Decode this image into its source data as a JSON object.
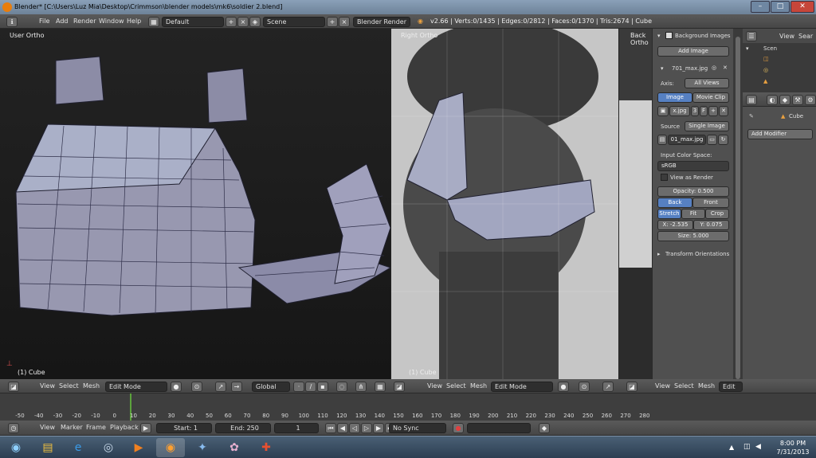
{
  "window": {
    "title": "Blender* [C:\\Users\\Luz Mia\\Desktop\\Crimmson\\blender models\\mk6\\soldier 2.blend]",
    "min": "–",
    "max": "□",
    "close": "✕"
  },
  "info_header": {
    "menus": [
      "File",
      "Add",
      "Render",
      "Window",
      "Help"
    ],
    "layout": "Default",
    "scene": "Scene",
    "engine": "Blender Render",
    "stats": "v2.66 | Verts:0/1435 | Edges:0/2812 | Faces:0/1370 | Tris:2674 | Cube"
  },
  "viewports": {
    "left": {
      "label": "User Ortho",
      "caption": "(1) Cube"
    },
    "middle": {
      "label": "Right Ortho",
      "caption": "(1) Cube"
    },
    "right": {
      "label": "Back Ortho"
    }
  },
  "props": {
    "section": "Background Images",
    "add_image": "Add Image",
    "image_name": "701_max.jpg",
    "axis_label": "Axis:",
    "axis_value": "All Views",
    "tab_image": "Image",
    "tab_movie": "Movie Clip",
    "img_file": "x.jpg",
    "img_users": "3",
    "img_f": "F",
    "source_label": "Source",
    "source_value": "Single Image",
    "file_path": "01_max.jpg",
    "color_space_label": "Input Color Space:",
    "color_space": "sRGB",
    "view_as_render": "View as Render",
    "opacity": "Opacity: 0.500",
    "back": "Back",
    "front": "Front",
    "stretch": "Stretch",
    "fit": "Fit",
    "crop": "Crop",
    "x": "X: -2.535",
    "y": "Y: 0.075",
    "size": "Size: 5.000",
    "transform": "Transform Orientations"
  },
  "outliner": {
    "view": "View",
    "search": "Sear",
    "scene": "Scen"
  },
  "modifier": {
    "object": "Cube",
    "add": "Add Modifier"
  },
  "viewport_header": {
    "view": "View",
    "select": "Select",
    "mesh": "Mesh",
    "mode": "Edit Mode",
    "orientation": "Global",
    "mode_short": "Edit"
  },
  "timeline": {
    "ticks": [
      "-50",
      "-40",
      "-30",
      "-20",
      "-10",
      "0",
      "10",
      "20",
      "30",
      "40",
      "50",
      "60",
      "70",
      "80",
      "90",
      "100",
      "110",
      "120",
      "130",
      "140",
      "150",
      "160",
      "170",
      "180",
      "190",
      "200",
      "210",
      "220",
      "230",
      "240",
      "250",
      "260",
      "270",
      "280"
    ],
    "view": "View",
    "marker": "Marker",
    "frame": "Frame",
    "playback": "Playback",
    "start": "Start: 1",
    "end": "End: 250",
    "current": "1",
    "sync": "No Sync"
  },
  "taskbar": {
    "time": "8:00 PM",
    "date": "7/31/2013"
  }
}
